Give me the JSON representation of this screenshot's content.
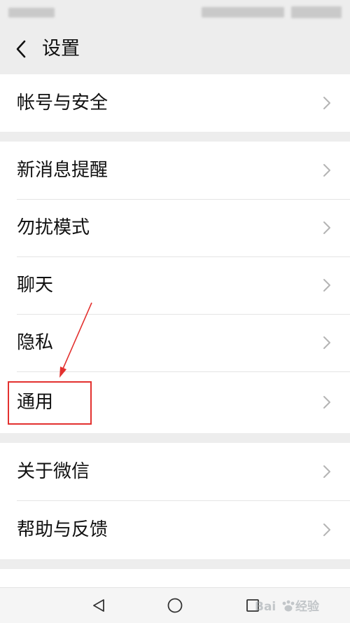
{
  "header": {
    "title": "设置"
  },
  "groups": [
    {
      "items": [
        {
          "label": "帐号与安全"
        }
      ]
    },
    {
      "items": [
        {
          "label": "新消息提醒"
        },
        {
          "label": "勿扰模式"
        },
        {
          "label": "聊天"
        },
        {
          "label": "隐私"
        },
        {
          "label": "通用"
        }
      ]
    },
    {
      "items": [
        {
          "label": "关于微信"
        },
        {
          "label": "帮助与反馈"
        }
      ]
    }
  ],
  "colors": {
    "background": "#ededed",
    "row_background": "#ffffff",
    "annotation": "#e3312f",
    "chevron": "#b4b4b4"
  },
  "icons": {
    "back": "chevron-left-icon",
    "row_arrow": "chevron-right-icon",
    "nav_back": "triangle-back-icon",
    "nav_home": "circle-home-icon",
    "nav_recent": "square-recent-icon"
  }
}
